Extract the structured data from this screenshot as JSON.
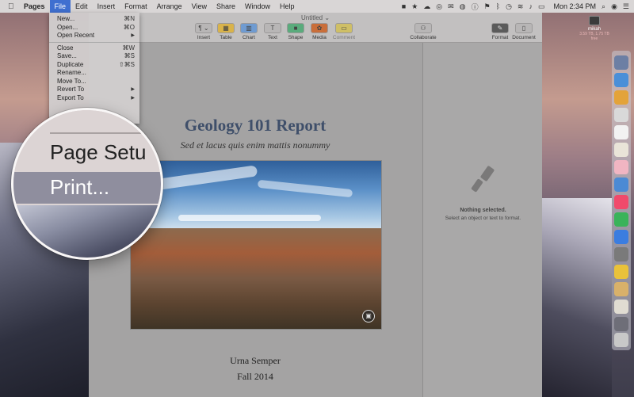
{
  "menubar": {
    "apple": "",
    "app_name": "Pages",
    "menus": [
      "File",
      "Edit",
      "Insert",
      "Format",
      "Arrange",
      "View",
      "Share",
      "Window",
      "Help"
    ],
    "clock": "Mon 2:34 PM"
  },
  "file_menu": {
    "items": [
      {
        "label": "New...",
        "shortcut": "⌘N"
      },
      {
        "label": "Open...",
        "shortcut": "⌘O"
      },
      {
        "label": "Open Recent",
        "submenu": "▶"
      },
      {
        "label": "Close",
        "shortcut": "⌘W"
      },
      {
        "label": "Save...",
        "shortcut": "⌘S"
      },
      {
        "label": "Duplicate",
        "shortcut": "⇧⌘S"
      },
      {
        "label": "Rename..."
      },
      {
        "label": "Move To..."
      },
      {
        "label": "Revert To",
        "submenu": "▶"
      },
      {
        "label": "Export To",
        "submenu": "▶"
      }
    ]
  },
  "magnifier": {
    "page_setup": "Page Setu",
    "print": "Print..."
  },
  "window": {
    "doc_name": "Untitled ⌄",
    "toolbar": {
      "insert": "Insert",
      "table": "Table",
      "chart": "Chart",
      "text": "Text",
      "shape": "Shape",
      "media": "Media",
      "comment": "Comment",
      "collaborate": "Collaborate",
      "format": "Format",
      "document": "Document"
    }
  },
  "document": {
    "title": "Geology 101 Report",
    "subtitle": "Sed et lacus quis enim mattis nonummy",
    "author": "Urna Semper",
    "date": "Fall 2014"
  },
  "sidebar": {
    "nothing_title": "Nothing selected.",
    "nothing_hint": "Select an object or text to format."
  },
  "desktop": {
    "disk_name": "mikah",
    "disk_size": "3.59 TB, 1.75 TB free"
  }
}
